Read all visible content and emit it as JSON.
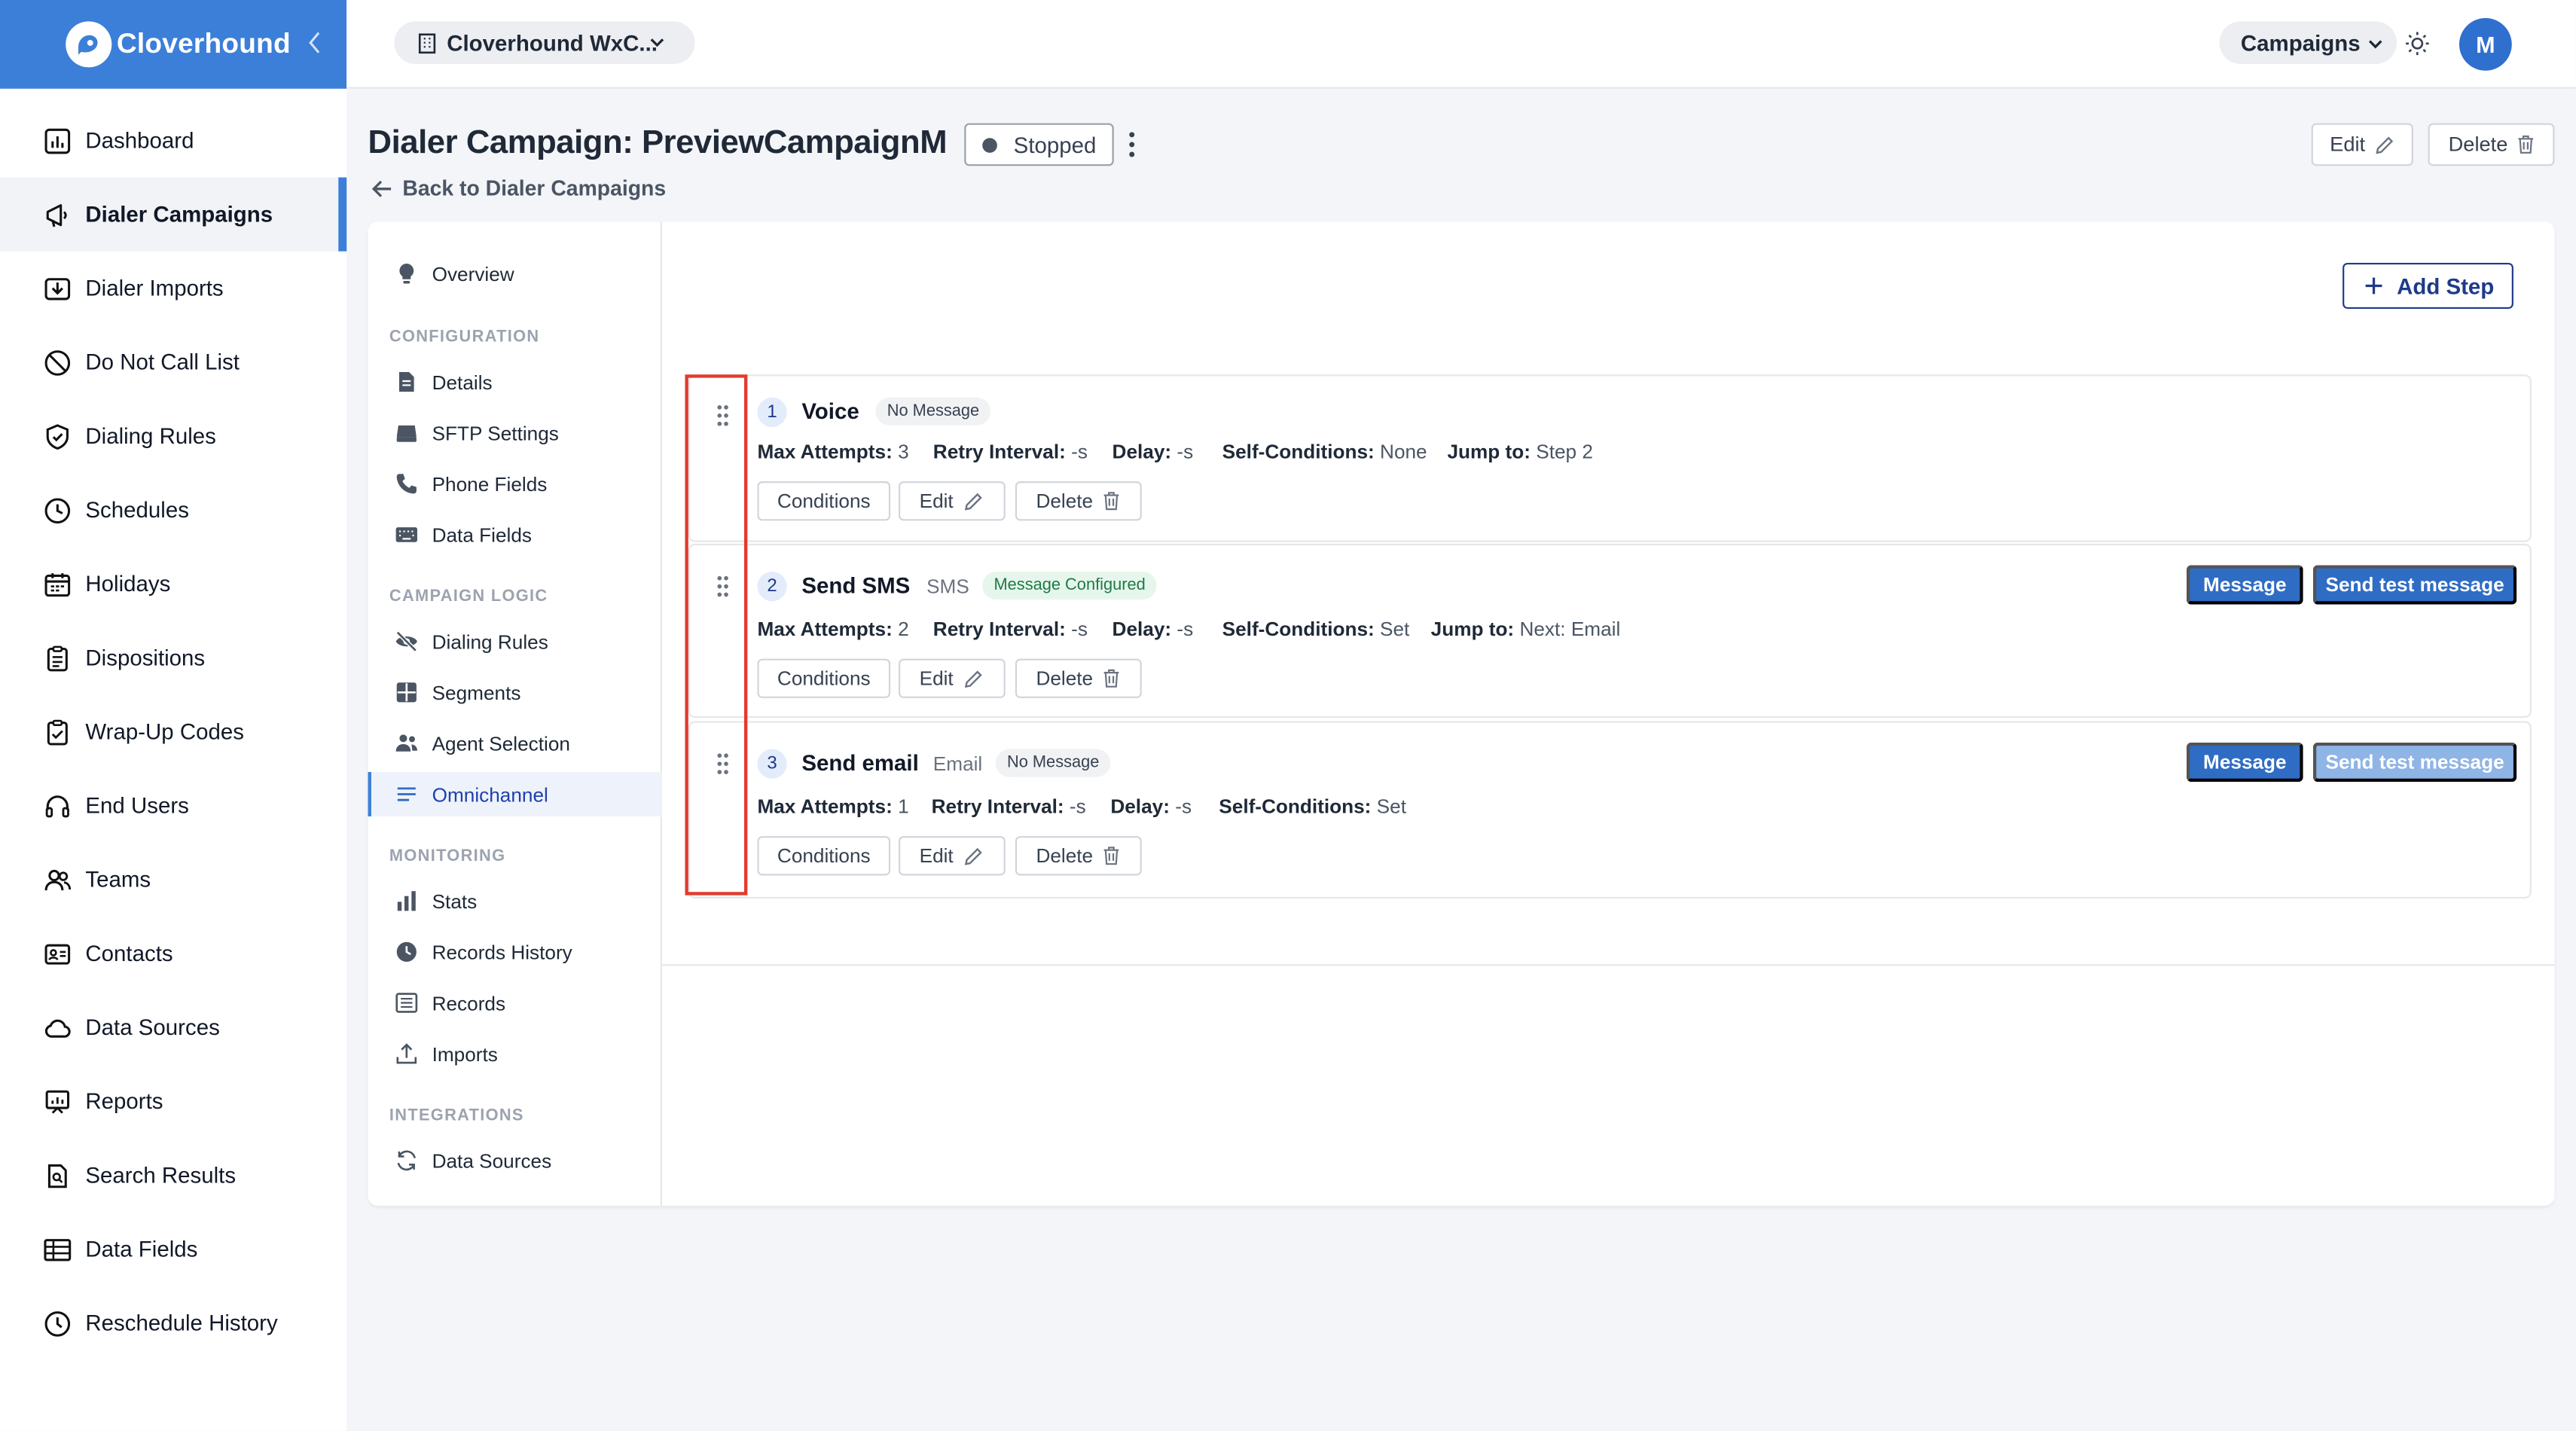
{
  "brand": {
    "name": "Cloverhound"
  },
  "topbar": {
    "org": "Cloverhound WxC...",
    "module": "Campaigns",
    "avatar_initial": "M"
  },
  "sidebar": {
    "items": [
      {
        "label": "Dashboard",
        "icon": "dashboard-icon"
      },
      {
        "label": "Dialer Campaigns",
        "icon": "megaphone-icon",
        "active": true
      },
      {
        "label": "Dialer Imports",
        "icon": "import-icon"
      },
      {
        "label": "Do Not Call List",
        "icon": "ban-icon"
      },
      {
        "label": "Dialing Rules",
        "icon": "shield-icon"
      },
      {
        "label": "Schedules",
        "icon": "clock-icon"
      },
      {
        "label": "Holidays",
        "icon": "calendar-icon"
      },
      {
        "label": "Dispositions",
        "icon": "clipboard-icon"
      },
      {
        "label": "Wrap-Up Codes",
        "icon": "clipboard-check-icon"
      },
      {
        "label": "End Users",
        "icon": "headset-icon"
      },
      {
        "label": "Teams",
        "icon": "users-icon"
      },
      {
        "label": "Contacts",
        "icon": "contact-card-icon"
      },
      {
        "label": "Data Sources",
        "icon": "cloud-icon"
      },
      {
        "label": "Reports",
        "icon": "report-icon"
      },
      {
        "label": "Search Results",
        "icon": "search-doc-icon"
      },
      {
        "label": "Data Fields",
        "icon": "table-icon"
      },
      {
        "label": "Reschedule History",
        "icon": "history-icon"
      }
    ]
  },
  "header": {
    "title": "Dialer Campaign: PreviewCampaignM",
    "status": "Stopped",
    "back_label": "Back to Dialer Campaigns",
    "edit_label": "Edit",
    "delete_label": "Delete"
  },
  "subnav": {
    "overview": "Overview",
    "sections": {
      "configuration": "CONFIGURATION",
      "campaign_logic": "CAMPAIGN LOGIC",
      "monitoring": "MONITORING",
      "integrations": "INTEGRATIONS"
    },
    "configuration": [
      "Details",
      "SFTP Settings",
      "Phone Fields",
      "Data Fields"
    ],
    "campaign_logic": [
      "Dialing Rules",
      "Segments",
      "Agent Selection",
      "Omnichannel"
    ],
    "monitoring": [
      "Stats",
      "Records History",
      "Records",
      "Imports"
    ],
    "integrations": [
      "Data Sources"
    ],
    "active": "Omnichannel"
  },
  "content": {
    "add_step_label": "Add Step",
    "labels": {
      "max_attempts": "Max Attempts:",
      "retry_interval": "Retry Interval:",
      "delay": "Delay:",
      "self_conditions": "Self-Conditions:",
      "jump_to": "Jump to:",
      "conditions": "Conditions",
      "edit": "Edit",
      "delete": "Delete",
      "message": "Message",
      "send_test": "Send test message"
    },
    "steps": [
      {
        "number": "1",
        "title": "Voice",
        "channel": "",
        "badge": "No Message",
        "max_attempts": "3",
        "retry_interval": "-s",
        "delay": "-s",
        "self_conditions": "None",
        "jump_to": "Step 2"
      },
      {
        "number": "2",
        "title": "Send SMS",
        "channel": "SMS",
        "badge": "Message Configured",
        "max_attempts": "2",
        "retry_interval": "-s",
        "delay": "-s",
        "self_conditions": "Set",
        "jump_to": "Next: Email"
      },
      {
        "number": "3",
        "title": "Send email",
        "channel": "Email",
        "badge": "No Message",
        "max_attempts": "1",
        "retry_interval": "-s",
        "delay": "-s",
        "self_conditions": "Set",
        "jump_to": ""
      }
    ]
  },
  "colors": {
    "brand": "#3b7fd9",
    "primary_button": "#2f6cc4",
    "disabled_button": "#8fb4e6",
    "highlight": "#e23b2e",
    "badge_configured": "#1f7a45"
  }
}
